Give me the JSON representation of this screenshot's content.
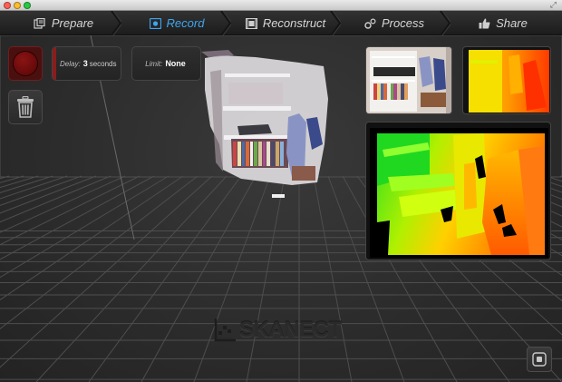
{
  "window": {
    "traffic_lights": [
      {
        "name": "close",
        "color": "#ff5f57"
      },
      {
        "name": "minimize",
        "color": "#febc2e"
      },
      {
        "name": "zoom",
        "color": "#28c840"
      }
    ],
    "fullscreen_icon": "fullscreen-arrows-icon"
  },
  "tabs": [
    {
      "label": "Prepare",
      "icon": "prepare-icon",
      "active": false
    },
    {
      "label": "Record",
      "icon": "record-icon",
      "active": true
    },
    {
      "label": "Reconstruct",
      "icon": "reconstruct-icon",
      "active": false
    },
    {
      "label": "Process",
      "icon": "process-icon",
      "active": false
    },
    {
      "label": "Share",
      "icon": "thumbs-up-icon",
      "active": false
    }
  ],
  "controls": {
    "record_button_icon": "record-icon",
    "delay": {
      "key": "Delay:",
      "value": "3",
      "unit": "seconds"
    },
    "limit": {
      "key": "Limit:",
      "value": "None"
    },
    "trash_icon": "trash-icon"
  },
  "views": {
    "thumbnail_rgb": "rgb-camera-view",
    "thumbnail_depth": "depth-camera-view",
    "depth_preview": "depth-preview"
  },
  "logo": {
    "text": "SKANECT"
  },
  "colors": {
    "accent": "#3ea5f0",
    "record_red": "#8e1b1b",
    "tab_text": "#d6d6d6"
  }
}
